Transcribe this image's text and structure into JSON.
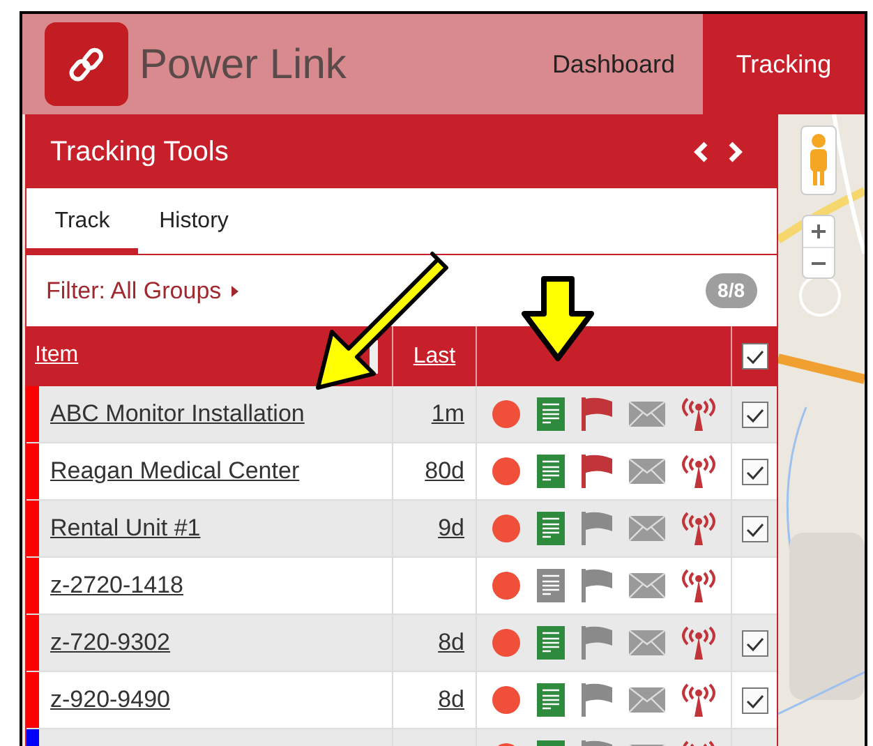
{
  "app": {
    "name": "Power Link"
  },
  "nav_tabs": [
    {
      "label": "Dashboard",
      "selected": false
    },
    {
      "label": "Tracking",
      "selected": true
    }
  ],
  "panel": {
    "title": "Tracking Tools"
  },
  "sub_tabs": [
    {
      "label": "Track",
      "selected": true
    },
    {
      "label": "History",
      "selected": false
    }
  ],
  "filter": {
    "label": "Filter: All Groups",
    "count": "8/8"
  },
  "table": {
    "columns": [
      "Item",
      "Last"
    ],
    "header_checked": true,
    "rows": [
      {
        "name": "ABC Monitor Installation",
        "last": "1m",
        "color": "#ff0000",
        "notes": true,
        "flagged": true,
        "checked": true
      },
      {
        "name": "Reagan Medical Center",
        "last": "80d",
        "color": "#ff0000",
        "notes": true,
        "flagged": true,
        "checked": true
      },
      {
        "name": "Rental Unit #1",
        "last": "9d",
        "color": "#ff0000",
        "notes": true,
        "flagged": false,
        "checked": true
      },
      {
        "name": "z-2720-1418",
        "color": "#ff0000",
        "notes": false,
        "flagged": false,
        "checked": null
      },
      {
        "name": "z-720-9302",
        "last": "8d",
        "color": "#ff0000",
        "notes": true,
        "flagged": false,
        "checked": true
      },
      {
        "name": "z-920-9490",
        "last": "8d",
        "color": "#ff0000",
        "notes": true,
        "flagged": false,
        "checked": true
      },
      {
        "color": "#0000ff",
        "notes": true,
        "flagged": false,
        "checked": null
      }
    ]
  }
}
